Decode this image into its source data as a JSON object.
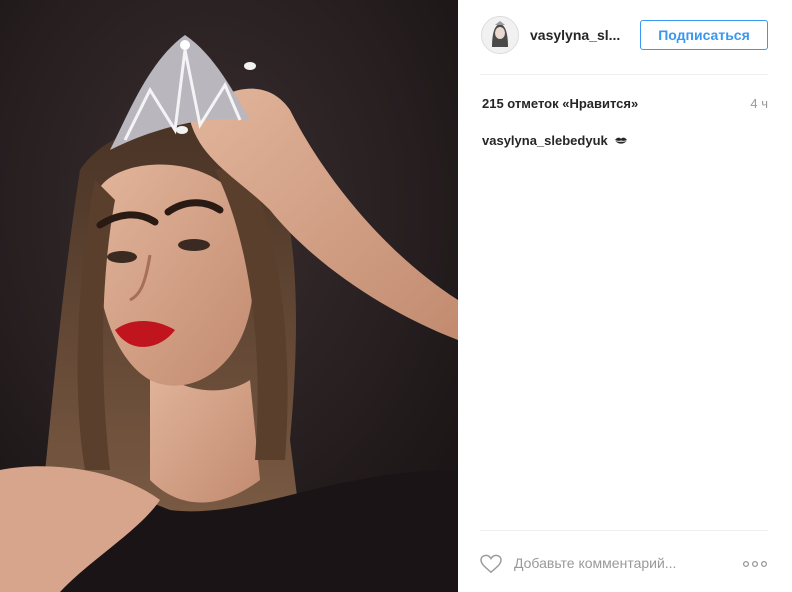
{
  "post": {
    "photo_alt": "",
    "header": {
      "username": "vasylyna_sl...",
      "follow_label": "Подписаться"
    },
    "likes_text": "215 отметок «Нравится»",
    "time_ago": "4 ч",
    "caption": {
      "username": "vasylyna_slebedyuk",
      "emoji_icon": "kiss-mark-icon"
    },
    "comment": {
      "placeholder": "Добавьте комментарий...",
      "like_icon": "heart-icon",
      "more_icon": "more-options-icon"
    },
    "colors": {
      "accent": "#3897f0",
      "text": "#262626",
      "muted": "#999999",
      "divider": "#efefef"
    }
  }
}
